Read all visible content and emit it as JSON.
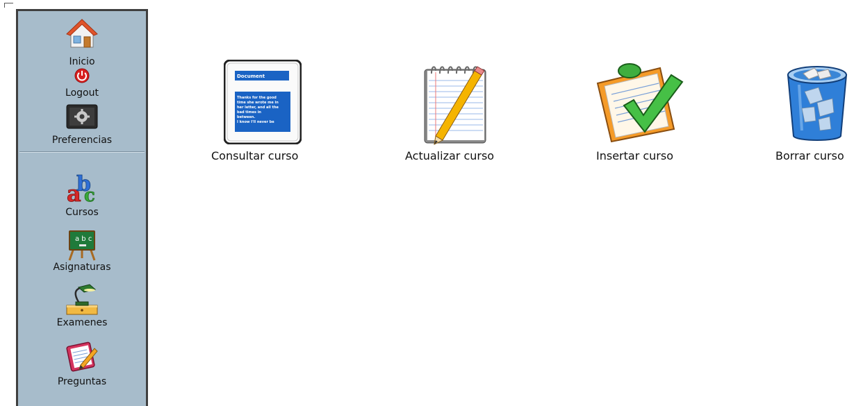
{
  "sidebar": {
    "top_items": [
      {
        "label": "Inicio",
        "icon": "home-icon"
      },
      {
        "label": "Logout",
        "icon": "power-icon"
      },
      {
        "label": "Preferencias",
        "icon": "settings-icon"
      }
    ],
    "bottom_items": [
      {
        "label": "Cursos",
        "icon": "abc-blocks-icon"
      },
      {
        "label": "Asignaturas",
        "icon": "chalkboard-icon"
      },
      {
        "label": "Examenes",
        "icon": "desk-lamp-icon"
      },
      {
        "label": "Preguntas",
        "icon": "notepad-pencil-icon"
      }
    ]
  },
  "main": {
    "tiles": [
      {
        "label": "Consultar curso",
        "icon": "document-icon"
      },
      {
        "label": "Actualizar curso",
        "icon": "notepad-pencil-icon"
      },
      {
        "label": "Insertar curso",
        "icon": "clipboard-check-icon"
      },
      {
        "label": "Borrar curso",
        "icon": "trash-bin-icon"
      }
    ],
    "document_preview": {
      "header": "Document",
      "body": "Thanks for the good time she wrote me in her letter, and all the bad times in between. I know I'll never be"
    }
  },
  "colors": {
    "sidebar_bg": "#a7bccb",
    "sidebar_border": "#3f3f3f",
    "doc_blue": "#1a63c4"
  }
}
